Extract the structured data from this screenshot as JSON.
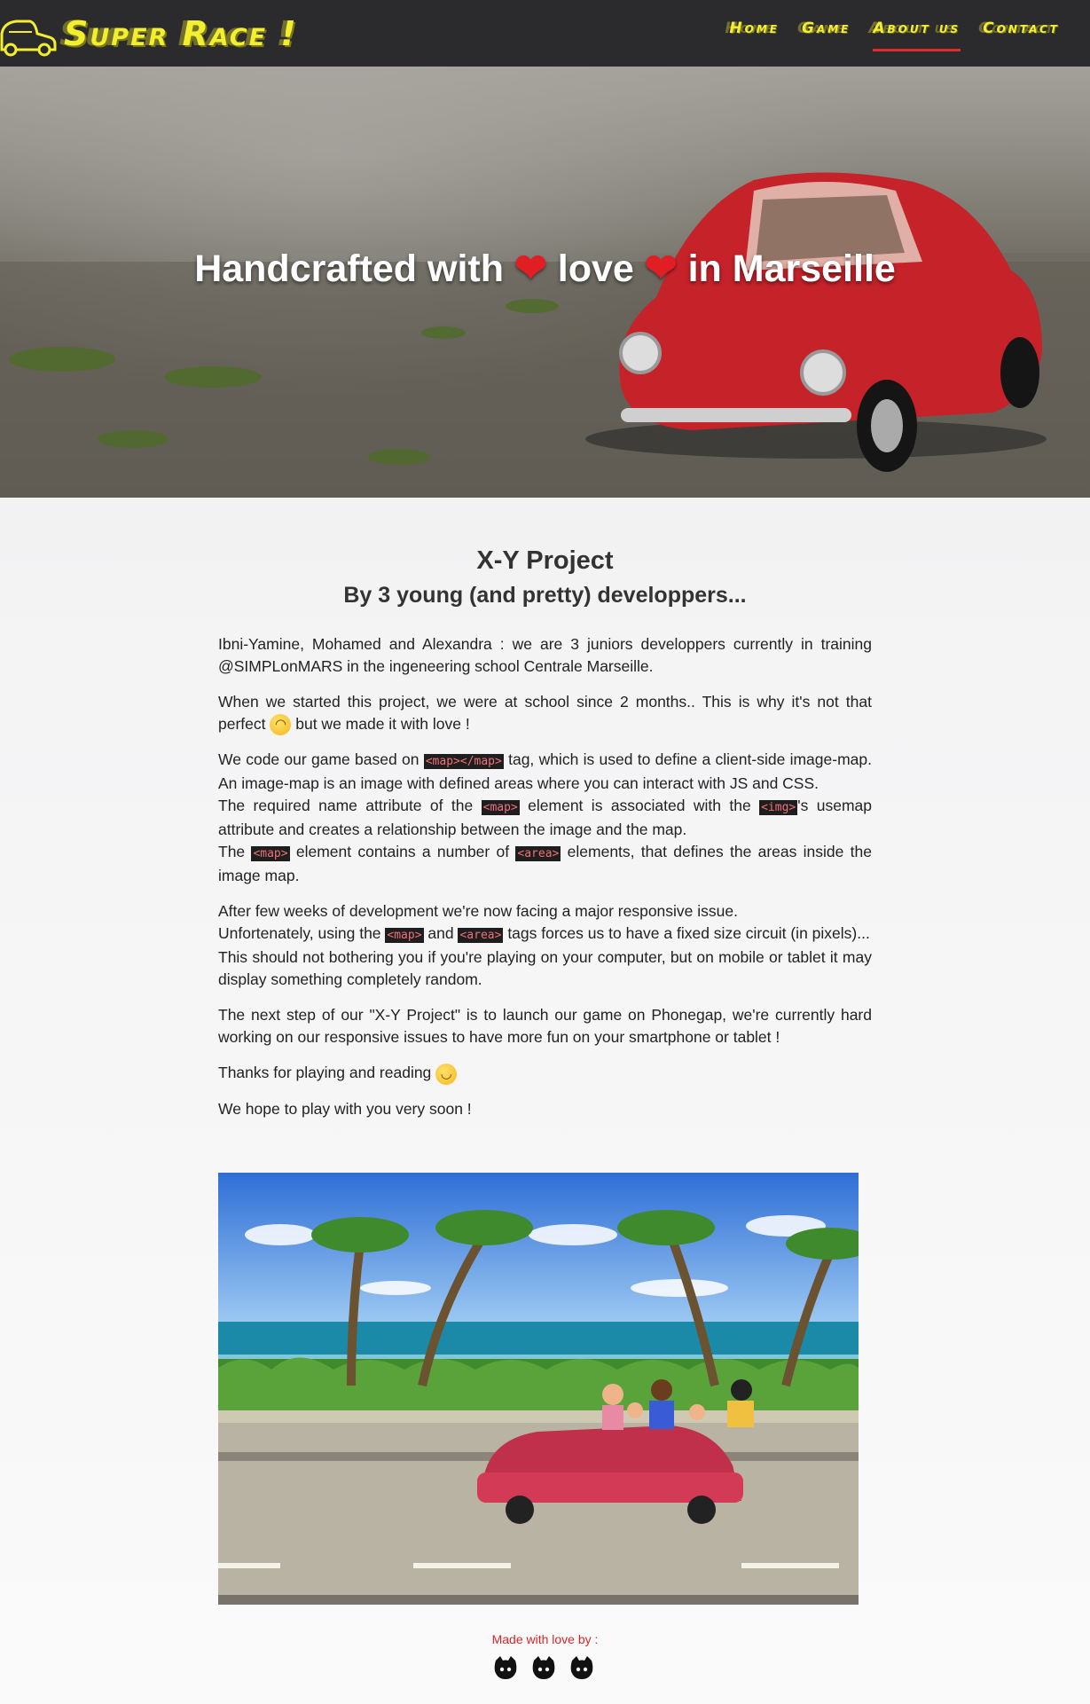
{
  "brand": {
    "name": "Super Race !"
  },
  "nav": {
    "items": [
      {
        "label": "Home",
        "active": false
      },
      {
        "label": "Game",
        "active": false
      },
      {
        "label": "About us",
        "active": true
      },
      {
        "label": "Contact",
        "active": false
      }
    ]
  },
  "hero": {
    "title_part1": "Handcrafted with ",
    "title_part2": " love ",
    "title_part3": " in Marseille",
    "heart": "❤"
  },
  "about": {
    "title": "X-Y Project",
    "subtitle": "By 3 young (and pretty) developpers...",
    "p1": "Ibni-Yamine, Mohamed and Alexandra : we are 3 juniors developpers currently in training @SIMPLonMARS in the ingeneering school Centrale Marseille.",
    "p2a": "When we started this project, we were at school since 2 months.. This is why it's not that perfect ",
    "p2b": " but we made it with love !",
    "p3a": "We code our game based on ",
    "code_map_tag": "<map></map>",
    "p3b": " tag, which is used to define a client-side image-map. An image-map is an image with defined areas where you can interact with JS and CSS.",
    "p3c": "The required name attribute of the ",
    "code_map": "<map>",
    "p3d": " element is associated with the ",
    "code_img": "<img>",
    "p3e": "'s usemap attribute and creates a relationship between the image and the map.",
    "p3f": "The ",
    "p3g": " element contains a number of ",
    "code_area": "<area>",
    "p3h": " elements, that defines the areas inside the image map.",
    "p4a": "After few weeks of development we're now facing a major responsive issue.",
    "p4b": "Unfortenately, using the ",
    "p4c": " and ",
    "p4d": " tags forces us to have a fixed size circuit (in pixels)...",
    "p4e": "This should not bothering you if you're playing on your computer, but on mobile or tablet it may display something completely random.",
    "p5": "The next step of our \"X-Y Project\" is to launch our game on Phonegap, we're currently hard working on our responsive issues to have more fun on your smartphone or tablet !",
    "p6": "Thanks for playing and reading ",
    "p7": "We hope to play with you very soon !"
  },
  "emojis": {
    "upside_down": "upside-down-face-emoji",
    "wink": "winking-face-emoji"
  },
  "footer": {
    "made_with": "Made with love by :"
  },
  "colors": {
    "nav_bg": "#2b2b2d",
    "brand_yellow": "#f3ee2f",
    "accent_red": "#e32b2b",
    "footer_red": "#d7262a"
  }
}
